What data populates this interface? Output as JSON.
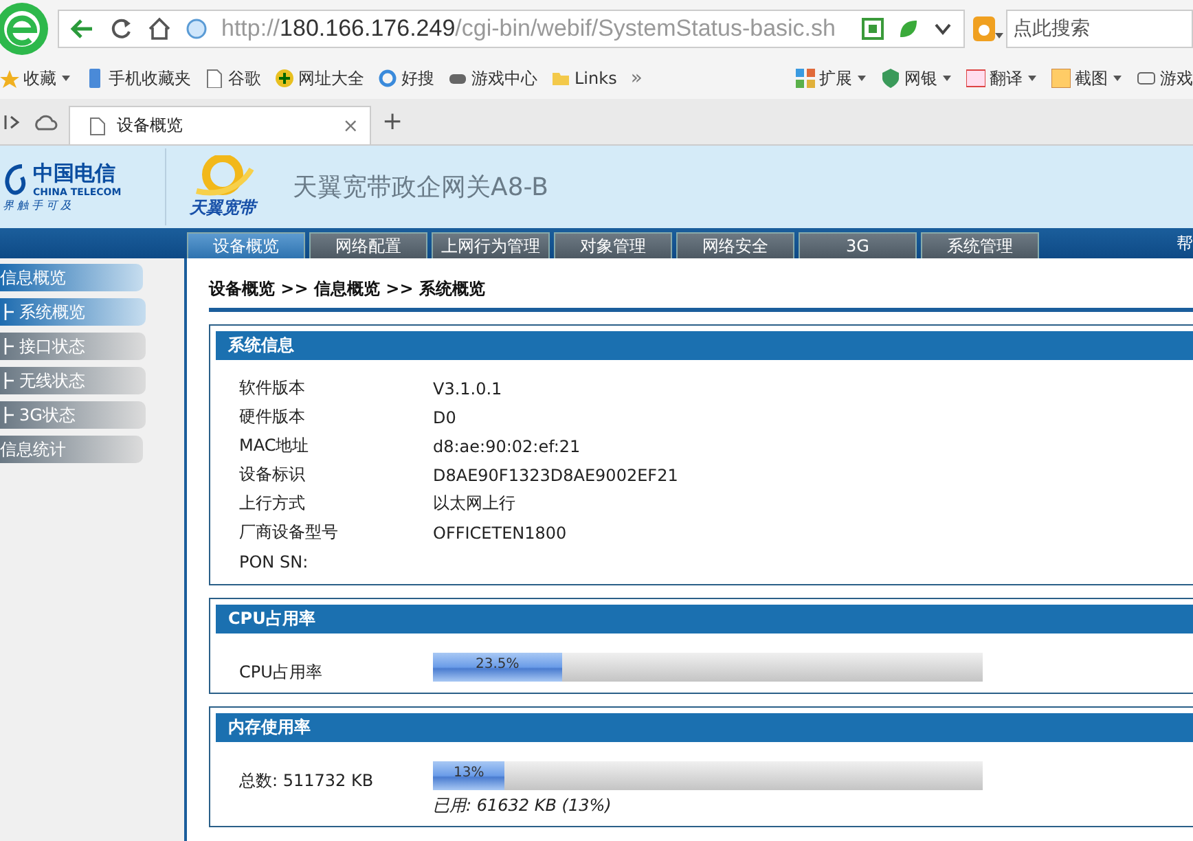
{
  "browser": {
    "url_scheme": "http://",
    "url_host": "180.166.176.249",
    "url_path": "/cgi-bin/webif/SystemStatus-basic.sh",
    "search_placeholder": "点此搜索",
    "bookmarks": [
      {
        "label": "收藏",
        "dropdown": true
      },
      {
        "label": "手机收藏夹",
        "dropdown": false
      },
      {
        "label": "谷歌",
        "dropdown": false
      },
      {
        "label": "网址大全",
        "dropdown": false
      },
      {
        "label": "好搜",
        "dropdown": false
      },
      {
        "label": "游戏中心",
        "dropdown": false
      },
      {
        "label": "Links",
        "dropdown": false
      }
    ],
    "more": "»",
    "tools": [
      {
        "label": "扩展",
        "dropdown": true
      },
      {
        "label": "网银",
        "dropdown": true
      },
      {
        "label": "翻译",
        "dropdown": true
      },
      {
        "label": "截图",
        "dropdown": true
      },
      {
        "label": "游戏",
        "dropdown": false
      }
    ],
    "tabs": [
      {
        "label": "设备概览",
        "selected": true
      }
    ],
    "close": "×",
    "new_tab": "+"
  },
  "header": {
    "logo_cn": "中国电信",
    "logo_en": "CHINA TELECOM",
    "slogan": "界 触 手 可 及",
    "brand": "天翼宽带",
    "title": "天翼宽带政企网关A8-B"
  },
  "nav": {
    "tabs": [
      {
        "label": "设备概览",
        "selected": true
      },
      {
        "label": "网络配置",
        "selected": false
      },
      {
        "label": "上网行为管理",
        "selected": false
      },
      {
        "label": "对象管理",
        "selected": false
      },
      {
        "label": "网络安全",
        "selected": false
      },
      {
        "label": "3G",
        "selected": false
      },
      {
        "label": "系统管理",
        "selected": false
      }
    ],
    "right": "帮"
  },
  "sidebar": {
    "items": [
      {
        "label": "信息概览",
        "selected": true,
        "children": [
          {
            "label": "系统概览",
            "selected": true
          },
          {
            "label": "接口状态",
            "selected": false
          },
          {
            "label": "无线状态",
            "selected": false
          },
          {
            "label": "3G状态",
            "selected": false
          }
        ]
      },
      {
        "label": "信息统计",
        "selected": false
      }
    ]
  },
  "breadcrumb": "设备概览 >> 信息概览 >> 系统概览",
  "panels": [
    {
      "kind": "info",
      "title": "系统信息",
      "rows": [
        {
          "label": "软件版本",
          "value": "V3.1.0.1"
        },
        {
          "label": "硬件版本",
          "value": "D0"
        },
        {
          "label": "MAC地址",
          "value": "d8:ae:90:02:ef:21"
        },
        {
          "label": "设备标识",
          "value": "D8AE90F1323D8AE9002EF21"
        },
        {
          "label": "上行方式",
          "value": "以太网上行"
        },
        {
          "label": "厂商设备型号",
          "value": "OFFICETEN1800"
        },
        {
          "label": "PON SN:",
          "value": ""
        }
      ]
    },
    {
      "kind": "meter",
      "title": "CPU占用率",
      "label": "CPU占用率",
      "level": 0.235,
      "reading": "23.5%"
    },
    {
      "kind": "meter",
      "title": "内存使用率",
      "label": "总数: 511732 KB",
      "level": 0.13,
      "reading": "13%",
      "note": "已用: 61632 KB (13%)"
    }
  ]
}
